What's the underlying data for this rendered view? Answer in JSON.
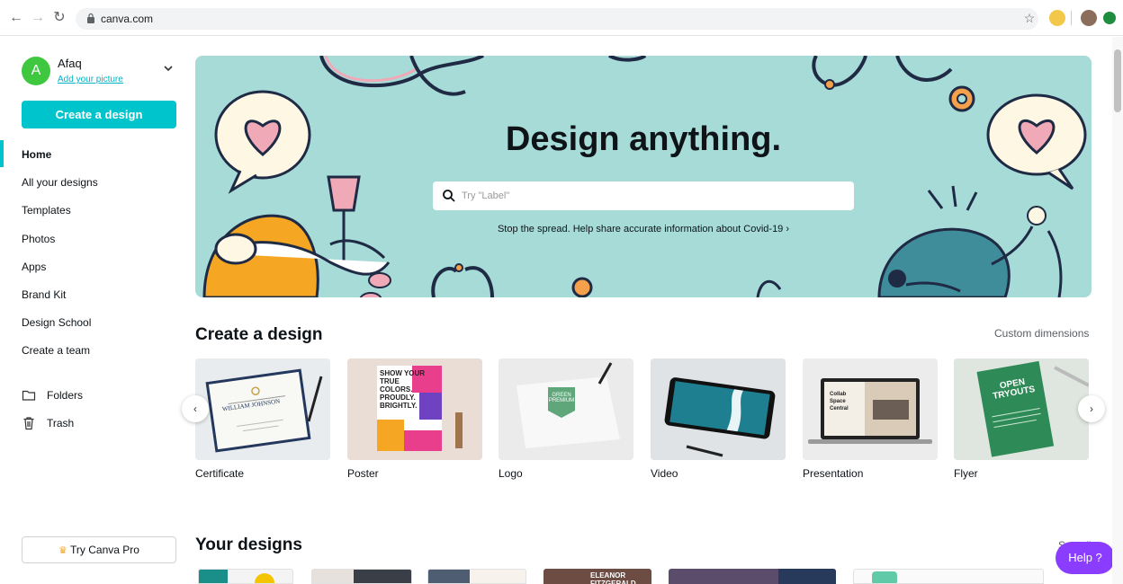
{
  "browser": {
    "url": "canva.com",
    "back_icon": "arrow-left-icon",
    "forward_icon": "arrow-right-icon",
    "reload_icon": "reload-icon"
  },
  "sidebar": {
    "user": {
      "initial": "A",
      "name": "Afaq",
      "add_picture": "Add your picture",
      "avatar_color": "#40c740"
    },
    "create_button": "Create a design",
    "nav": [
      {
        "label": "Home",
        "active": true
      },
      {
        "label": "All your designs"
      },
      {
        "label": "Templates"
      },
      {
        "label": "Photos"
      },
      {
        "label": "Apps"
      },
      {
        "label": "Brand Kit"
      },
      {
        "label": "Design School"
      },
      {
        "label": "Create a team"
      }
    ],
    "folders_label": "Folders",
    "trash_label": "Trash",
    "pro_button": "Try Canva Pro",
    "accent": "#00c4cc"
  },
  "hero": {
    "title": "Design anything.",
    "search_placeholder": "Try \"Label\"",
    "covid_text": "Stop the spread. Help share accurate information about Covid-19 ›",
    "bg_color": "#a7dbd8"
  },
  "create_section": {
    "title": "Create a design",
    "custom_dimensions": "Custom dimensions",
    "cards": [
      {
        "label": "Certificate",
        "cert_title": "WILLIAM JOHNSON"
      },
      {
        "label": "Poster",
        "poster_text": "SHOW YOUR TRUE COLORS. PROUDLY. BRIGHTLY."
      },
      {
        "label": "Logo",
        "logo_text": "GREEN PREMIUM"
      },
      {
        "label": "Video"
      },
      {
        "label": "Presentation",
        "slide_text": "Collab Space Central"
      },
      {
        "label": "Flyer",
        "flyer_text": "OPEN TRYOUTS"
      }
    ]
  },
  "your_designs": {
    "title": "Your designs",
    "see_all": "See all",
    "thumb_text": "ELEANOR FITZGERALD"
  },
  "help": {
    "label": "Help ?",
    "color": "#8b3dff"
  }
}
